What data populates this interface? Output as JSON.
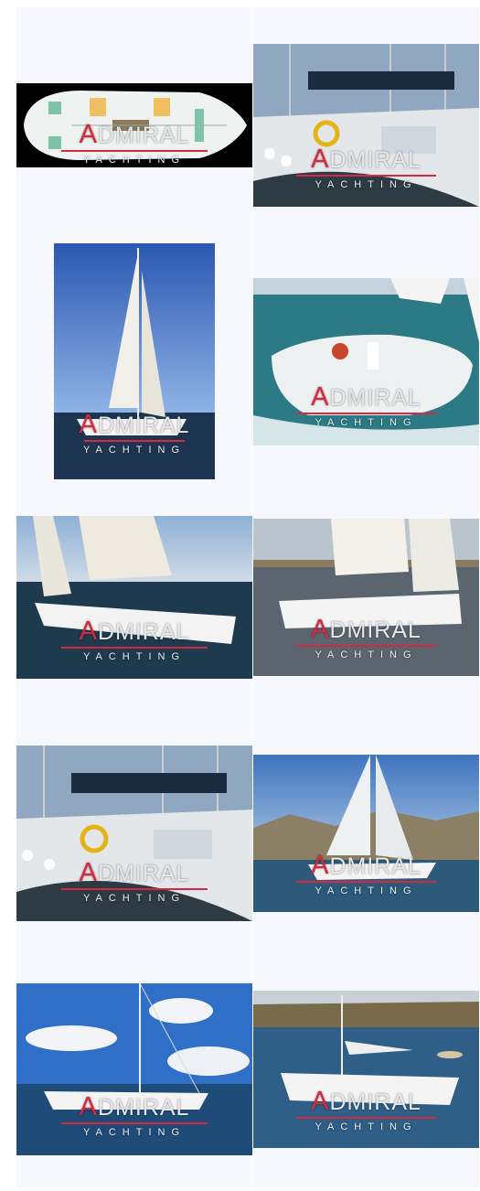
{
  "gallery": {
    "watermark": {
      "initial": "A",
      "rest": "DMIRAL",
      "sub": "YACHTING"
    },
    "colors": {
      "cell_bg": "#f6f8fd",
      "brand_red": "#d6283f"
    },
    "images": [
      {
        "subject": "deck-layout-plan"
      },
      {
        "subject": "yacht-cockpit-in-marina"
      },
      {
        "subject": "yacht-sailing-portrait"
      },
      {
        "subject": "yacht-stern-under-sail"
      },
      {
        "subject": "yacht-sailing-side-view"
      },
      {
        "subject": "yacht-sailing-bay"
      },
      {
        "subject": "yacht-cockpit-in-marina"
      },
      {
        "subject": "yacht-sailing-mountains"
      },
      {
        "subject": "yacht-at-anchor-clouds"
      },
      {
        "subject": "yacht-near-shore"
      }
    ]
  }
}
